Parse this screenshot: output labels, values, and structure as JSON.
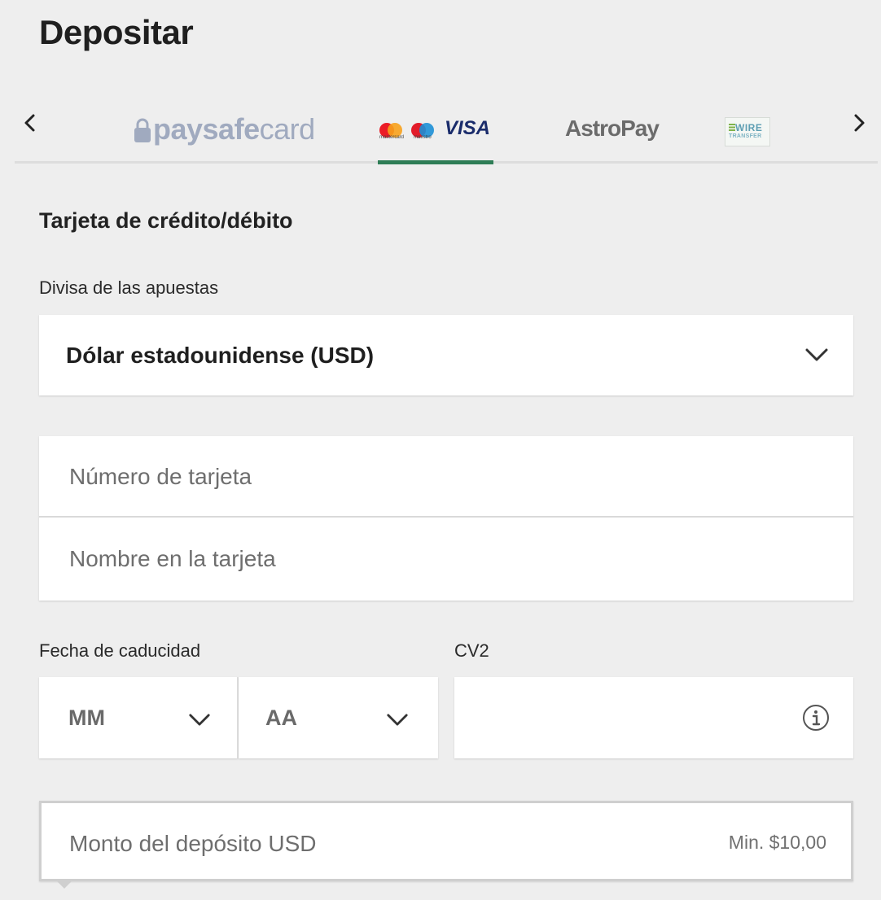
{
  "page": {
    "title": "Depositar"
  },
  "payment_methods": {
    "tabs": [
      {
        "id": "paysafecard",
        "label_bold": "paysafe",
        "label_thin": "card",
        "selected": false
      },
      {
        "id": "cards",
        "mastercard_label": "mastercard",
        "maestro_label": "maestro",
        "visa_label": "VISA",
        "selected": true
      },
      {
        "id": "astropay",
        "label": "AstroPay",
        "selected": false
      },
      {
        "id": "wire-transfer",
        "label_top": "WIRE",
        "label_bottom": "TRANSFER",
        "selected": false
      }
    ],
    "accent_color": "#2e7d56"
  },
  "form": {
    "section_title": "Tarjeta de crédito/débito",
    "currency_label": "Divisa de las apuestas",
    "currency_value": "Dólar estadounidense (USD)",
    "card_number_placeholder": "Número de tarjeta",
    "card_name_placeholder": "Nombre en la tarjeta",
    "expiry_label": "Fecha de caducidad",
    "expiry_month": "MM",
    "expiry_year": "AA",
    "cv2_label": "CV2",
    "amount_placeholder": "Monto del depósito USD",
    "amount_min": "Min. $10,00"
  },
  "icons": {
    "prev": "chevron-left-icon",
    "next": "chevron-right-icon",
    "dropdown": "chevron-down-icon",
    "info": "info-icon",
    "lock": "lock-icon"
  }
}
